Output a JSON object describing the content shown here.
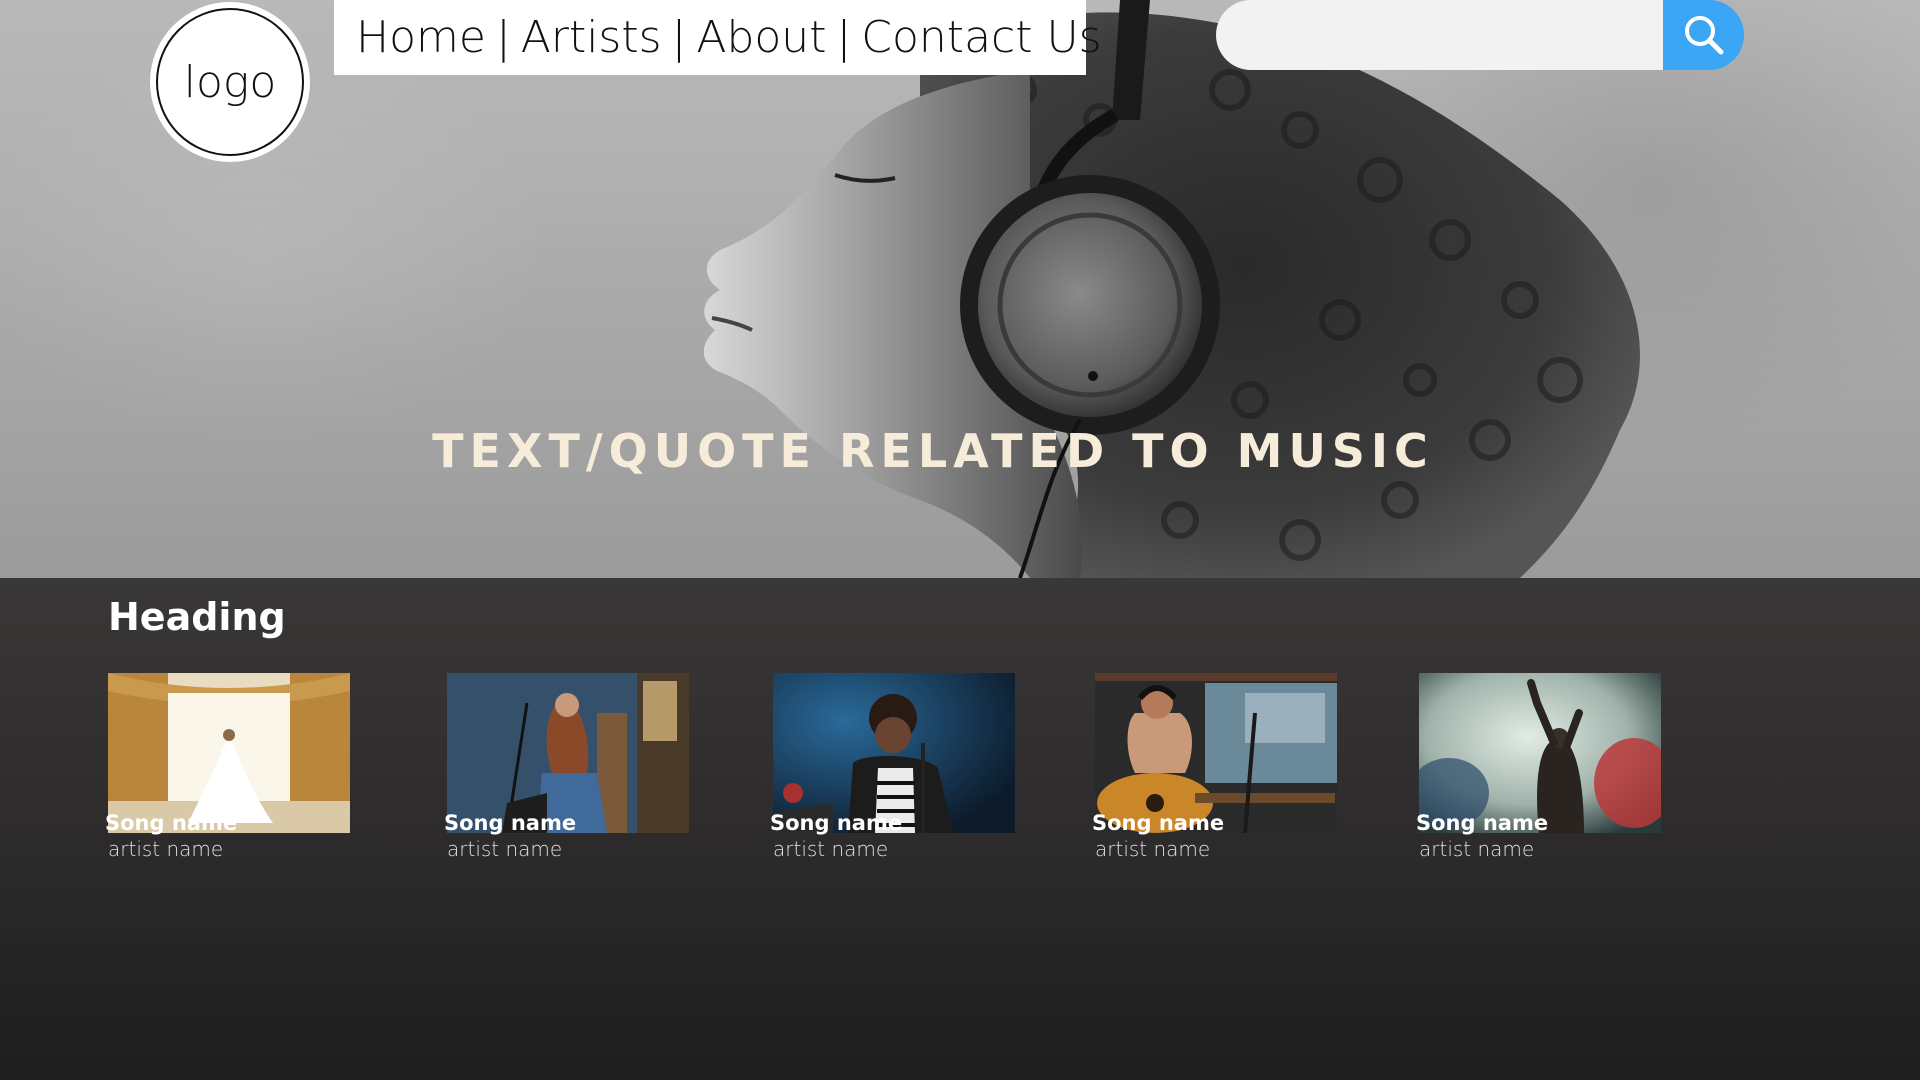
{
  "logo": {
    "text": "logo"
  },
  "nav": {
    "items": [
      {
        "label": "Home"
      },
      {
        "label": "Artists"
      },
      {
        "label": "About"
      },
      {
        "label": "Contact Us"
      }
    ],
    "separator": "|"
  },
  "search": {
    "value": "",
    "placeholder": "",
    "button_icon": "search-icon",
    "accent_color": "#3aa6f5"
  },
  "hero": {
    "quote": "TEXT/QUOTE RELATED TO MUSIC",
    "photo": "woman-with-headphones"
  },
  "section": {
    "heading": "Heading",
    "cards": [
      {
        "song": "Song name",
        "artist": "artist name",
        "thumbnail": "bride-in-window"
      },
      {
        "song": "Song name",
        "artist": "artist name",
        "thumbnail": "guitarist-at-mic"
      },
      {
        "song": "Song name",
        "artist": "artist name",
        "thumbnail": "singer-on-stage"
      },
      {
        "song": "Song name",
        "artist": "artist name",
        "thumbnail": "studio-guitar-singer"
      },
      {
        "song": "Song name",
        "artist": "artist name",
        "thumbnail": "concert-performer"
      }
    ]
  }
}
